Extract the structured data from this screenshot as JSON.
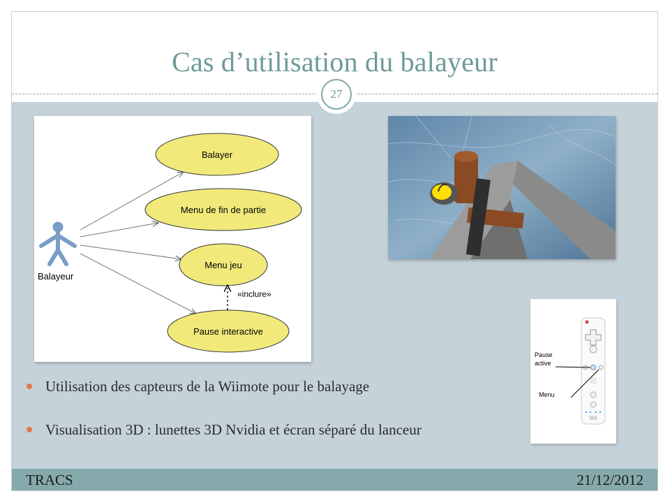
{
  "slide": {
    "title": "Cas d’utilisation du balayeur",
    "page_number": "27"
  },
  "uml": {
    "actor": "Balayeur",
    "use_cases": [
      "Balayer",
      "Menu de fin de partie",
      "Menu jeu",
      "Pause interactive"
    ],
    "include_label": "«inclure»"
  },
  "photo": {
    "subject": "3D curling game view: sweeper broom over ice with yellow stone"
  },
  "wiimote": {
    "label_pause_line1": "Pause",
    "label_pause_line2": "active",
    "label_menu": "Menu",
    "brand": "Wii"
  },
  "bullets": [
    "Utilisation des capteurs de la Wiimote pour le balayage",
    "Visualisation 3D : lunettes 3D Nvidia et écran séparé du lanceur"
  ],
  "footer": {
    "left": "TRACS",
    "right": "21/12/2012"
  },
  "colors": {
    "title": "#6e9a97",
    "body_bg": "#c5d2d9",
    "footer_bg": "#86aaab",
    "use_case_fill": "#f1ea7b",
    "bullet": "#e07a4a"
  }
}
